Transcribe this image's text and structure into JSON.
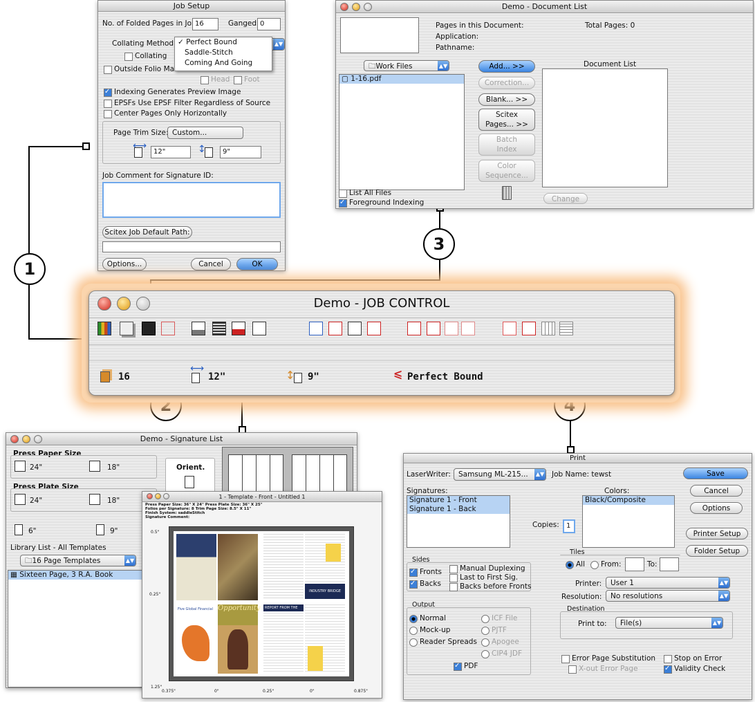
{
  "callouts": [
    "1",
    "2",
    "3",
    "4"
  ],
  "job_setup": {
    "title": "Job Setup",
    "folded_pages_label": "No. of Folded Pages in Job:",
    "folded_pages_value": "16",
    "ganged_label": "Ganged:",
    "ganged_value": "0",
    "collating_label": "Collating Method:",
    "collating_options": [
      "Perfect Bound",
      "Saddle-Stitch",
      "Coming And Going"
    ],
    "collating_selected": "Perfect Bound",
    "collating_check": "Collating",
    "outside_folio": "Outside Folio Mark",
    "head": "Head",
    "foot": "Foot",
    "indexing_preview": "Indexing Generates Preview Image",
    "epsf_filter": "EPSFs Use EPSF Filter Regardless of Source",
    "center_pages": "Center Pages Only Horizontally",
    "page_trim_label": "Page Trim Size:",
    "page_trim_value": "Custom...",
    "width_value": "12\"",
    "height_value": "9\"",
    "job_comment_label": "Job Comment for Signature ID:",
    "default_path_button": "Scitex Job Default Path:",
    "options_button": "Options...",
    "cancel_button": "Cancel",
    "ok_button": "OK"
  },
  "document_list": {
    "title": "Demo - Document List",
    "pages_label": "Pages in this Document:",
    "total_pages_label": "Total Pages: 0",
    "application_label": "Application:",
    "pathname_label": "Pathname:",
    "folder_popup": "Work Files",
    "files": [
      "1-16.pdf"
    ],
    "add_button": "Add... >>",
    "correction_button": "Correction...",
    "blank_button": "Blank... >>",
    "scitex_button_line1": "Scitex",
    "scitex_button_line2": "Pages... >>",
    "batch_button_line1": "Batch",
    "batch_button_line2": "Index",
    "color_button_line1": "Color",
    "color_button_line2": "Sequence...",
    "document_list_header": "Document List",
    "list_all_files": "List All Files",
    "foreground_indexing": "Foreground Indexing",
    "change_button": "Change"
  },
  "job_control": {
    "title": "Demo - JOB CONTROL",
    "pages_count": "16",
    "width": "12\"",
    "height": "9\"",
    "binding": "Perfect Bound",
    "accent": "#f7a65c"
  },
  "signature_list": {
    "title": "Demo - Signature List",
    "press_paper_label": "Press Paper Size",
    "paper_w": "24\"",
    "paper_h": "18\"",
    "press_plate_label": "Press Plate Size",
    "plate_w": "24\"",
    "plate_h": "18\"",
    "orient_label": "Orient.",
    "page_w": "6\"",
    "page_h": "9\"",
    "library_label": "Library List - All Templates",
    "template_popup": "16 Page Templates",
    "templates": [
      "Sixteen Page, 3 R.A. Book"
    ]
  },
  "template_window": {
    "title": "1 - Template - Front - Untitled 1",
    "header_lines": [
      "Press Paper Size: 36\" X 24\"   Press Plate Size: 36\" X 25\"",
      "Folios per Signature: 8   Trim Page Size: 8.5\" X 11\"",
      "Finish System: saddleStitch",
      "Signature Comment:"
    ],
    "y_ticks": [
      "0.5\"",
      "0.25\"",
      "1.25\""
    ],
    "x_ticks": [
      "0.375\"",
      "0\"",
      "0.25\"",
      "0\"",
      "0.875\""
    ],
    "page_texts": [
      "Opportunity",
      "REPORT FROM THE",
      "Five Global Financial",
      "INDUSTRY BRIDGE"
    ]
  },
  "print_dialog": {
    "title": "Print",
    "laserwriter_label": "LaserWriter:",
    "laserwriter_value": "Samsung ML-215...",
    "job_name_label": "Job Name: tewst",
    "save_button": "Save",
    "cancel_button": "Cancel",
    "options_button": "Options",
    "printer_setup_button": "Printer Setup",
    "folder_setup_button": "Folder Setup",
    "signatures_label": "Signatures:",
    "signatures": [
      "Signature 1 - Front",
      "Signature 1 - Back"
    ],
    "copies_label": "Copies:",
    "copies_value": "1",
    "colors_label": "Colors:",
    "colors": [
      "Black/Composite"
    ],
    "sides_label": "Sides",
    "fronts": "Fronts",
    "backs": "Backs",
    "manual_duplexing": "Manual Duplexing",
    "last_to_first": "Last to First Sig.",
    "backs_before_fronts": "Backs before Fronts",
    "tiles_label": "Tiles",
    "tiles_all": "All",
    "tiles_from": "From:",
    "tiles_to": "To:",
    "printer_label": "Printer:",
    "printer_value": "User 1",
    "resolution_label": "Resolution:",
    "resolution_value": "No resolutions",
    "output_label": "Output",
    "normal": "Normal",
    "mockup": "Mock-up",
    "reader_spreads": "Reader Spreads",
    "icf_file": "ICF File",
    "pjtf": "PJTF",
    "apogee": "Apogee",
    "cip4": "CIP4 JDF",
    "pdf": "PDF",
    "destination_label": "Destination",
    "print_to_label": "Print to:",
    "print_to_value": "File(s)",
    "error_page_sub": "Error Page Substitution",
    "xout_error": "X-out Error Page",
    "stop_on_error": "Stop on Error",
    "validity_check": "Validity Check"
  }
}
